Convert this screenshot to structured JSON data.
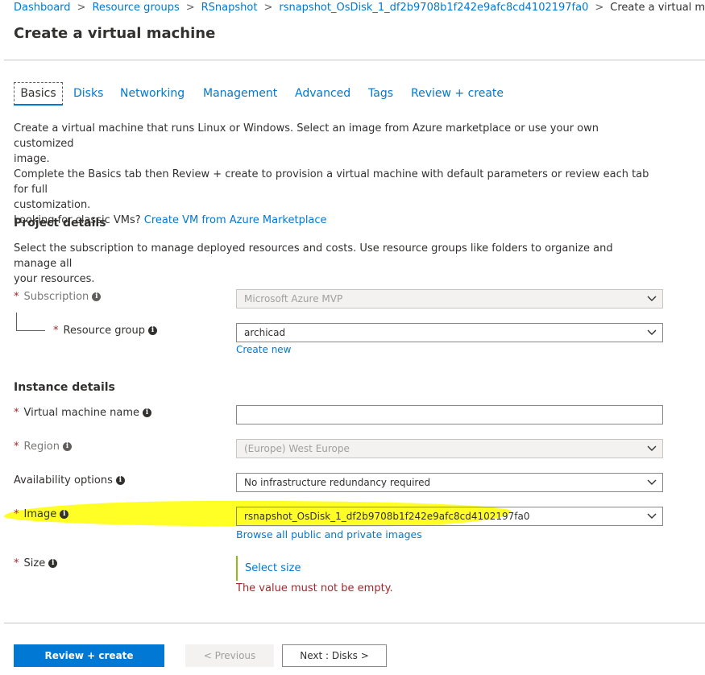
{
  "breadcrumb": {
    "items": [
      "Dashboard",
      "Resource groups",
      "RSnapshot",
      "rsnapshot_OsDisk_1_df2b9708b1f242e9afc8cd4102197fa0"
    ],
    "current": "Create a virtual machine"
  },
  "page_title": "Create a virtual machine",
  "tabs": [
    "Basics",
    "Disks",
    "Networking",
    "Management",
    "Advanced",
    "Tags",
    "Review + create"
  ],
  "intro": {
    "line1": "Create a virtual machine that runs Linux or Windows. Select an image from Azure marketplace or use your own customized",
    "line1b": "image.",
    "line2": "Complete the Basics tab then Review + create to provision a virtual machine with default parameters or review each tab for full",
    "line2b": "customization.",
    "line3": "Looking for classic VMs?",
    "line3_link": "Create VM from Azure Marketplace"
  },
  "project": {
    "heading": "Project details",
    "desc1": "Select the subscription to manage deployed resources and costs. Use resource groups like folders to organize and manage all",
    "desc2": "your resources.",
    "subscription_label": "Subscription",
    "subscription_value": "Microsoft Azure MVP",
    "resource_group_label": "Resource group",
    "resource_group_value": "archicad",
    "create_new": "Create new"
  },
  "instance": {
    "heading": "Instance details",
    "vm_name_label": "Virtual machine name",
    "vm_name_value": "",
    "region_label": "Region",
    "region_value": "(Europe) West Europe",
    "availability_label": "Availability options",
    "availability_value": "No infrastructure redundancy required",
    "image_label": "Image",
    "image_value": "rsnapshot_OsDisk_1_df2b9708b1f242e9afc8cd4102197fa0",
    "browse_images": "Browse all public and private images",
    "size_label": "Size",
    "select_size": "Select size",
    "size_error": "The value must not be empty."
  },
  "footer": {
    "review_create": "Review + create",
    "previous": "< Previous",
    "next": "Next : Disks >"
  },
  "icons": {
    "required": "*",
    "info": "i",
    "highlight_color": "#ffff00"
  }
}
